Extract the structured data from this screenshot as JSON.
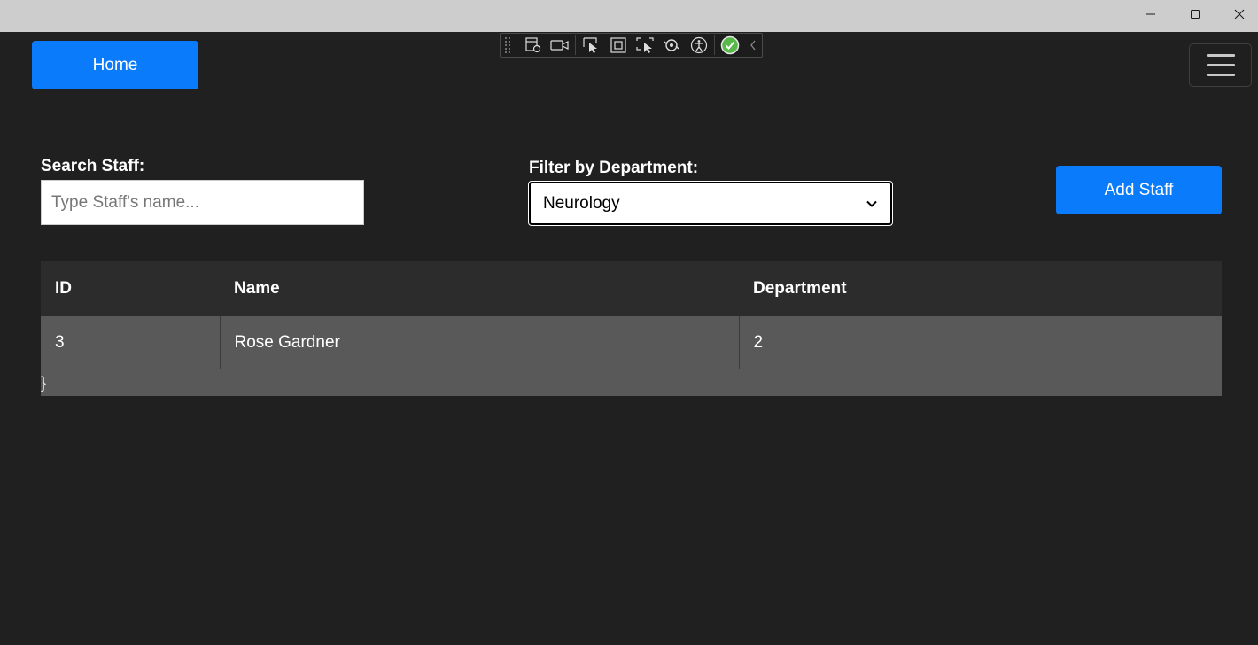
{
  "window": {
    "controls": {
      "minimize_icon": "minimize-icon",
      "maximize_icon": "maximize-icon",
      "close_icon": "close-icon"
    }
  },
  "nav": {
    "home_label": "Home",
    "menu_icon": "hamburger-icon"
  },
  "devtools": {
    "tools": [
      "live-visual-tree-icon",
      "video-record-icon",
      "select-element-icon",
      "display-layout-adorners-icon",
      "track-focus-icon",
      "hot-reload-icon",
      "accessibility-icon",
      "binding-check-icon",
      "collapse-chevron-icon"
    ]
  },
  "search": {
    "label": "Search Staff:",
    "placeholder": "Type Staff's name...",
    "value": ""
  },
  "filter": {
    "label": "Filter by Department:",
    "selected": "Neurology"
  },
  "actions": {
    "add_label": "Add Staff"
  },
  "table": {
    "headers": [
      "ID",
      "Name",
      "Department"
    ],
    "rows": [
      [
        "3",
        "Rose Gardner",
        "2"
      ]
    ],
    "trailing_text": "}"
  },
  "colors": {
    "accent": "#0a7bfa",
    "background": "#202020",
    "header_row": "#2c2c2c",
    "data_row": "#595959"
  }
}
